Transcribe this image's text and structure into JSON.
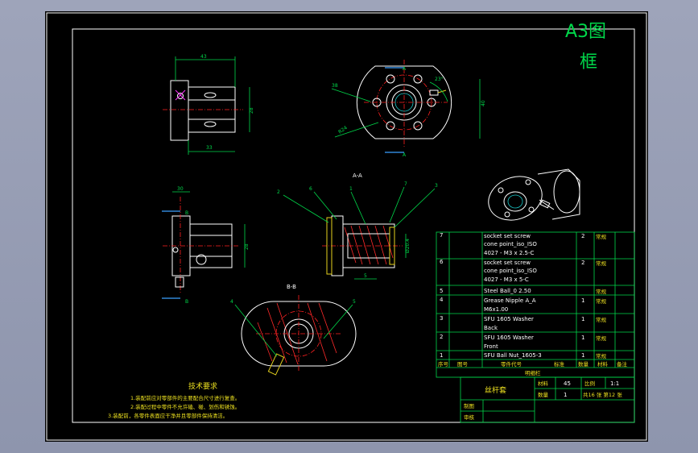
{
  "frame_title": [
    "A3图",
    "框"
  ],
  "section_labels": {
    "aa": "A-A",
    "bb": "B-B",
    "a_top": "A",
    "a_bottom": "A",
    "b_top": "B",
    "b_bottom": "B"
  },
  "dimensions": {
    "front_width": "43",
    "front_lower": "33",
    "front_height": "28",
    "side_top": "30",
    "side_height": "28",
    "flange_dia": "38",
    "radius": "R24",
    "angle": "23°",
    "flange_height": "40",
    "aa_dia": "Ø20.4",
    "aa_bottom": "5"
  },
  "balloons": {
    "aa": [
      "2",
      "6",
      "1",
      "7",
      "3"
    ],
    "bb": [
      "4",
      "5"
    ]
  },
  "tech_req": {
    "title": "技术要求",
    "lines": [
      "1.装配前应对零部件的主要配合尺寸进行复查。",
      "2.装配过程中零件不允许磕、碰、划伤和锈蚀。",
      "3.装配前，各零件表面应干净并且零部件保持清洁。"
    ]
  },
  "bom": {
    "rows": [
      {
        "no": "7",
        "name": [
          "socket set screw",
          "cone point_iso_ISO",
          "4027 - M3 x 2.5-C"
        ],
        "qty": "2",
        "note": "常规"
      },
      {
        "no": "6",
        "name": [
          "socket set screw",
          "cone point_iso_ISO",
          "4027 - M3 x 5-C"
        ],
        "qty": "2",
        "note": "常规"
      },
      {
        "no": "5",
        "name": [
          "Steel Ball_0 2.50"
        ],
        "qty": "",
        "note": "常规"
      },
      {
        "no": "4",
        "name": [
          "Grease Nipple A_A",
          "M6x1.00"
        ],
        "qty": "1",
        "note": "常规"
      },
      {
        "no": "3",
        "name": [
          "SFU 1605 Washer",
          "Back"
        ],
        "qty": "1",
        "note": "常规"
      },
      {
        "no": "2",
        "name": [
          "SFU 1605 Washer",
          "Front"
        ],
        "qty": "1",
        "note": "常规"
      },
      {
        "no": "1",
        "name": [
          "SFU Ball Nut_1605-3"
        ],
        "qty": "1",
        "note": "常规"
      }
    ],
    "header": [
      "序号",
      "图号",
      "零件代号",
      "标准",
      "数量",
      "材料",
      "备注"
    ],
    "caption": "明细栏"
  },
  "title_block": {
    "name": "丝杆套",
    "material_label": "材料",
    "material_value": "45",
    "scale_label": "比例",
    "scale_value": "1:1",
    "qty_label": "数量",
    "qty_value": "1",
    "sheets_text": "共16 张  第12 张",
    "drawn_label": "制图",
    "check_label": "审核"
  },
  "colors": {
    "paper": "#000000",
    "line": "#00d84a",
    "outline": "#ffffff",
    "center": "#ff2020",
    "viewer_bg": "#9aa0b6"
  }
}
